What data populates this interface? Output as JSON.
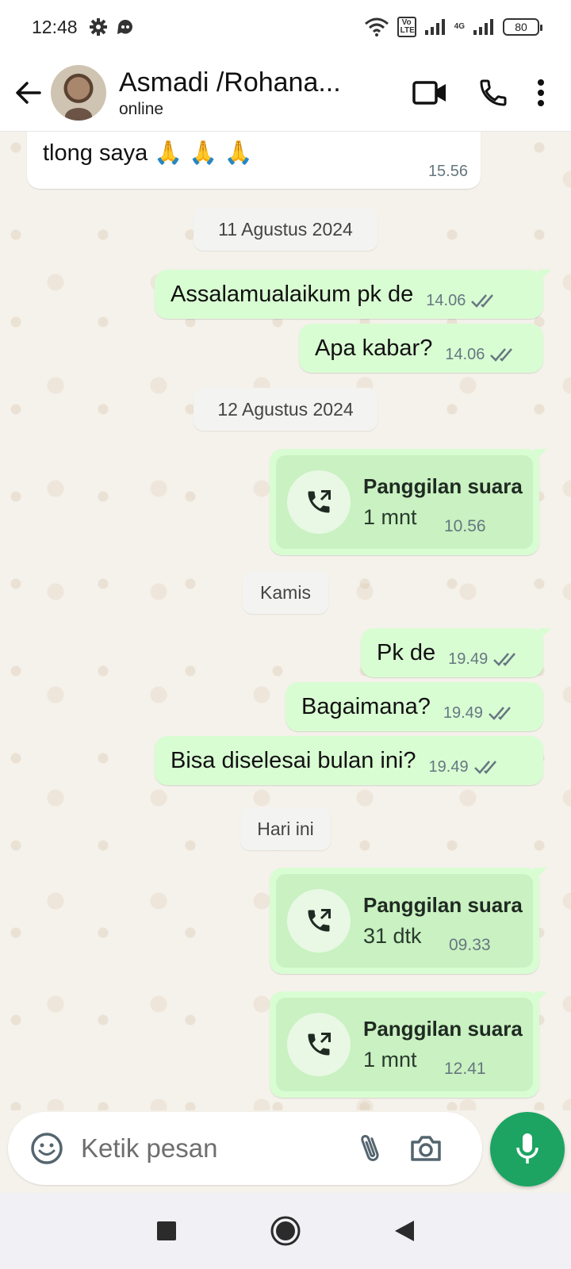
{
  "status_bar": {
    "time": "12:48",
    "battery": "80",
    "volte_label": "Vo LTE",
    "network_label": "4G"
  },
  "header": {
    "contact_name": "Asmadi /Rohana...",
    "contact_status": "online"
  },
  "composer": {
    "placeholder": "Ketik pesan"
  },
  "messages": {
    "m0": {
      "text": "tlong saya 🙏 🙏 🙏",
      "time": "15.56"
    },
    "d1": "11 Agustus 2024",
    "m1": {
      "text": "Assalamualaikum pk de",
      "time": "14.06"
    },
    "m2": {
      "text": "Apa kabar?",
      "time": "14.06"
    },
    "d2": "12 Agustus 2024",
    "c1": {
      "title": "Panggilan suara",
      "duration": "1 mnt",
      "time": "10.56"
    },
    "d3": "Kamis",
    "m3": {
      "text": "Pk de",
      "time": "19.49"
    },
    "m4": {
      "text": "Bagaimana?",
      "time": "19.49"
    },
    "m5": {
      "text": "Bisa diselesai bulan ini?",
      "time": "19.49"
    },
    "d4": "Hari ini",
    "c2": {
      "title": "Panggilan suara",
      "duration": "31 dtk",
      "time": "09.33"
    },
    "c3": {
      "title": "Panggilan suara",
      "duration": "1 mnt",
      "time": "12.41"
    }
  },
  "colors": {
    "outgoing_bubble": "#d9fdd3",
    "call_card": "#c9f1c1",
    "accent_green": "#1da462",
    "read_ticks": "#667781"
  },
  "icons": [
    "settings-icon",
    "notification-icon",
    "wifi-icon",
    "signal-icon",
    "back-arrow-icon",
    "video-call-icon",
    "voice-call-icon",
    "more-options-icon",
    "outgoing-call-icon",
    "double-check-icon",
    "emoji-icon",
    "attach-icon",
    "camera-icon",
    "microphone-icon",
    "nav-recents-icon",
    "nav-home-icon",
    "nav-back-icon"
  ]
}
